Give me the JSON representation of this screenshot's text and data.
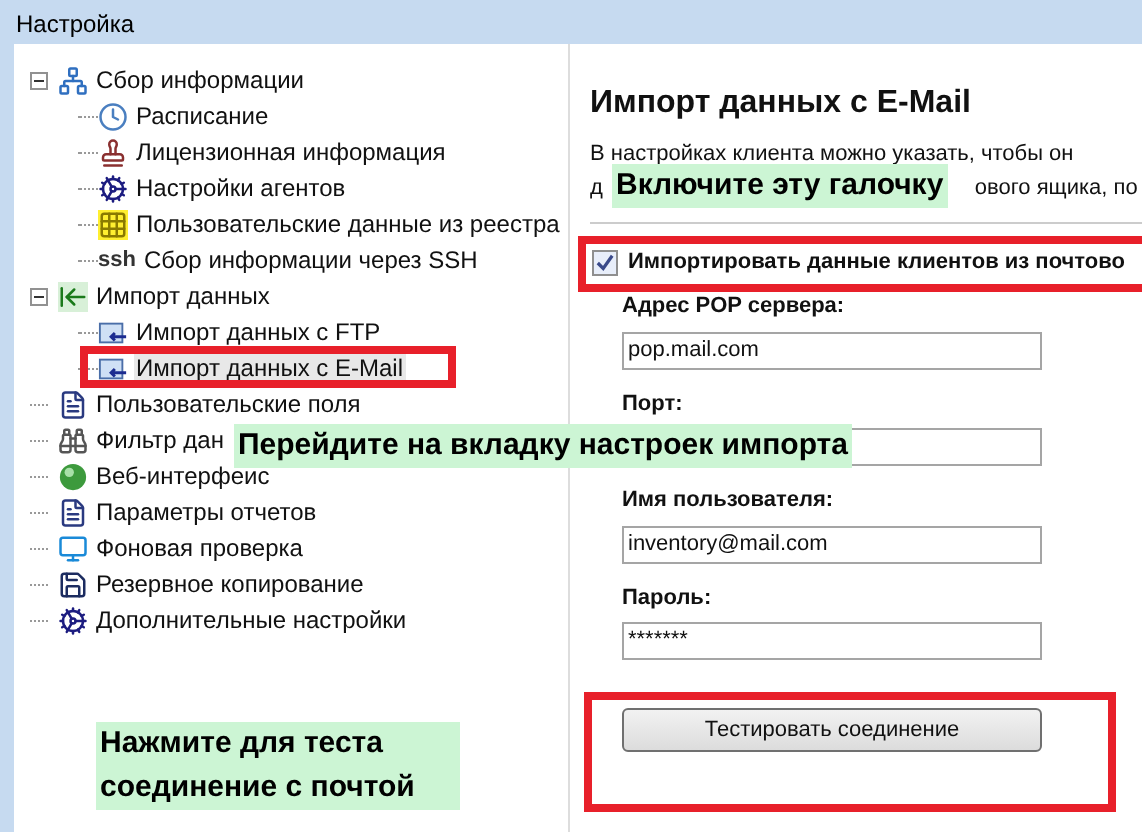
{
  "window": {
    "title": "Настройка"
  },
  "tree": [
    {
      "label": "Сбор информации",
      "expanded": true,
      "selected": false,
      "children": [
        {
          "label": "Расписание",
          "selected": false
        },
        {
          "label": "Лицензионная информация",
          "selected": false
        },
        {
          "label": "Настройки агентов",
          "selected": false
        },
        {
          "label": "Пользовательские данные из реестра",
          "selected": false
        },
        {
          "label": "Сбор информации через SSH",
          "selected": false,
          "icon_text": "ssh"
        }
      ]
    },
    {
      "label": "Импорт данных",
      "expanded": true,
      "selected": false,
      "children": [
        {
          "label": "Импорт данных с FTP",
          "selected": false
        },
        {
          "label": "Импорт данных с E-Mail",
          "selected": true
        }
      ]
    },
    {
      "label": "Пользовательские поля",
      "selected": false
    },
    {
      "label": "Фильтр дан",
      "selected": false
    },
    {
      "label": "Веб-интерфеис",
      "selected": false
    },
    {
      "label": "Параметры отчетов",
      "selected": false
    },
    {
      "label": "Фоновая проверка",
      "selected": false
    },
    {
      "label": "Резервное копирование",
      "selected": false
    },
    {
      "label": "Дополнительные настройки",
      "selected": false
    }
  ],
  "panel": {
    "heading": "Импорт данных с E-Mail",
    "description_line_1": "В настройках клиента можно указать, чтобы он",
    "description_line_2_start": "д",
    "description_line_2_end": "ового ящика, по",
    "checkbox": {
      "label": "Импортировать данные клиентов из почтово",
      "checked": true
    },
    "fields": [
      {
        "label": "Адрес POP сервера:",
        "value": "pop.mail.com"
      },
      {
        "label": "Порт:"
      },
      {
        "label": "Имя пользователя:",
        "value": "inventory@mail.com"
      },
      {
        "label": "Пароль:",
        "value": "*******"
      }
    ],
    "button": "Тестировать соединение"
  },
  "callouts": [
    {
      "text": "Включите эту галочку"
    },
    {
      "text": "Перейдите на вкладку настроек импорта"
    },
    {
      "text": "Нажмите для теста соединение с почтой"
    }
  ]
}
